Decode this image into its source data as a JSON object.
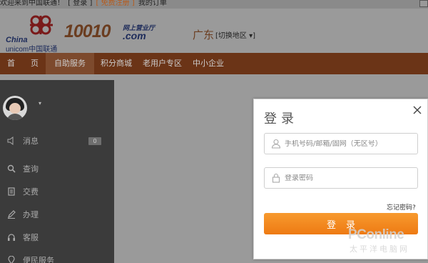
{
  "topbar": {
    "welcome": "欢迎来到中国联通！",
    "login_link": "[ 登录 ]",
    "register_link": "[ 免费注册 ]",
    "orders_link": "我的订单"
  },
  "header": {
    "brand_en_line1": "China",
    "brand_en_line2": "unicom中国联通",
    "brand_number": "10010",
    "brand_sub": "网上营业厅",
    "brand_com": ".com",
    "region": "广东",
    "region_switch": "[切换地区 ▾]"
  },
  "nav": {
    "items": [
      {
        "label": "首　　页"
      },
      {
        "label": "自助服务"
      },
      {
        "label": "积分商城"
      },
      {
        "label": "老用户专区"
      },
      {
        "label": "中小企业"
      }
    ]
  },
  "sidebar": {
    "user_caret": "▾",
    "items": [
      {
        "label": "消息",
        "icon": "speaker-icon"
      },
      {
        "label": "查询",
        "icon": "search-icon"
      },
      {
        "label": "交费",
        "icon": "bill-icon"
      },
      {
        "label": "办理",
        "icon": "pen-icon"
      },
      {
        "label": "客服",
        "icon": "headset-icon"
      },
      {
        "label": "便民服务",
        "icon": "location-icon"
      }
    ],
    "message_count": "0"
  },
  "login_modal": {
    "title": "登录",
    "account_placeholder": "手机号码/邮箱/固网（无区号）",
    "password_placeholder": "登录密码",
    "forgot_password": "忘记密码?",
    "login_button": "登录"
  },
  "watermark": {
    "line1": "PConline",
    "line2": "太平洋电脑网"
  },
  "colors": {
    "nav_bg": "#6b3417",
    "sidebar_bg": "#3b3b3b",
    "button_orange": "#f08418"
  }
}
